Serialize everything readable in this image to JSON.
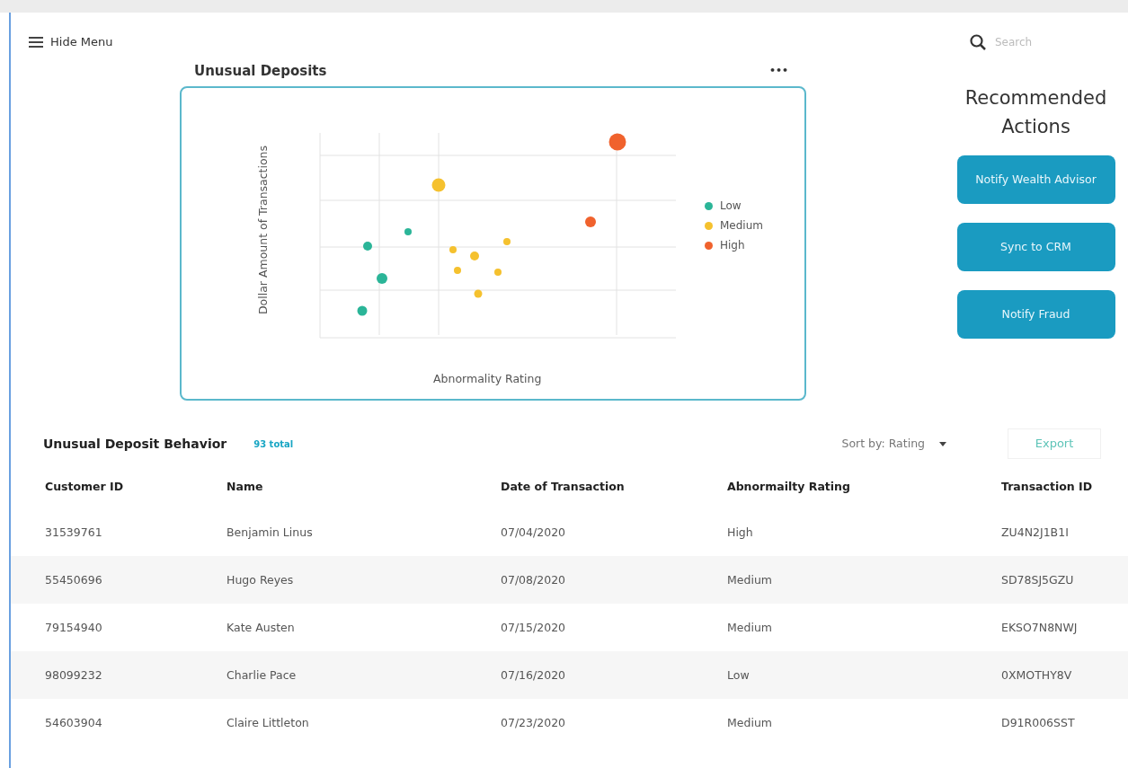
{
  "header": {
    "menu_label": "Hide Menu",
    "search": {
      "placeholder": "Search"
    }
  },
  "chart_card": {
    "title": "Unusual Deposits",
    "menu": "•••",
    "ylabel": "Dollar Amount of Transactions",
    "xlabel": "Abnormality Rating",
    "legend": [
      {
        "label": "Low",
        "color": "#2bb598"
      },
      {
        "label": "Medium",
        "color": "#f5c12e"
      },
      {
        "label": "High",
        "color": "#f0622d"
      }
    ]
  },
  "recommended": {
    "title": "Recommended Actions",
    "buttons": [
      "Notify Wealth Advisor",
      "Sync to CRM",
      "Notify Fraud"
    ]
  },
  "table": {
    "title": "Unusual Deposit Behavior",
    "count": "93 total",
    "sort": "Sort by: Rating",
    "export": "Export",
    "columns": [
      "Customer ID",
      "Name",
      "Date of Transaction",
      "Abnormailty Rating",
      "Transaction ID"
    ],
    "rows": [
      [
        "31539761",
        "Benjamin Linus",
        "07/04/2020",
        "High",
        "ZU4N2J1B1I"
      ],
      [
        "55450696",
        "Hugo Reyes",
        "07/08/2020",
        "Medium",
        "SD78SJ5GZU"
      ],
      [
        "79154940",
        "Kate Austen",
        "07/15/2020",
        "Medium",
        "EKSO7N8NWJ"
      ],
      [
        "98099232",
        "Charlie Pace",
        "07/16/2020",
        "Low",
        "0XMOTHY8V"
      ],
      [
        "54603904",
        "Claire Littleton",
        "07/23/2020",
        "Medium",
        "D91R006SST"
      ]
    ]
  }
}
